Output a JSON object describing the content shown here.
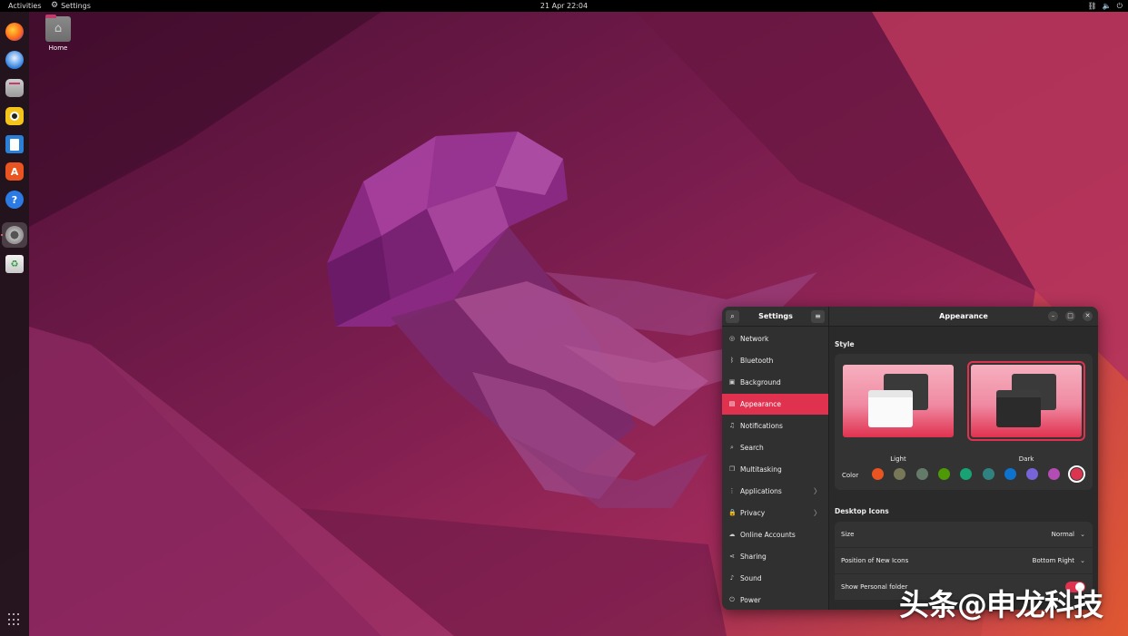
{
  "topbar": {
    "activities": "Activities",
    "app_name": "Settings",
    "clock": "21 Apr  22:04",
    "tray_icons": [
      "network-icon",
      "volume-icon",
      "power-icon"
    ]
  },
  "dock": {
    "apps": [
      {
        "name": "Firefox",
        "icon": "firefox-icon"
      },
      {
        "name": "Thunderbird",
        "icon": "thunderbird-icon"
      },
      {
        "name": "Files",
        "icon": "files-icon"
      },
      {
        "name": "Rhythmbox",
        "icon": "rhythmbox-icon"
      },
      {
        "name": "LibreOffice Writer",
        "icon": "writer-icon"
      },
      {
        "name": "Ubuntu Software",
        "icon": "software-icon"
      },
      {
        "name": "Help",
        "icon": "help-icon"
      },
      {
        "name": "Settings",
        "icon": "settings-icon"
      },
      {
        "name": "Trash",
        "icon": "trash-icon"
      }
    ],
    "show_apps_icon": "grid-icon"
  },
  "desktop": {
    "home_label": "Home"
  },
  "settings": {
    "sidebar_title": "Settings",
    "sidebar_items": [
      {
        "label": "Network",
        "icon": "network-icon"
      },
      {
        "label": "Bluetooth",
        "icon": "bluetooth-icon"
      },
      {
        "label": "Background",
        "icon": "background-icon"
      },
      {
        "label": "Appearance",
        "icon": "appearance-icon",
        "active": true
      },
      {
        "label": "Notifications",
        "icon": "bell-icon"
      },
      {
        "label": "Search",
        "icon": "search-icon"
      },
      {
        "label": "Multitasking",
        "icon": "multitasking-icon"
      },
      {
        "label": "Applications",
        "icon": "apps-icon",
        "chevron": true
      },
      {
        "label": "Privacy",
        "icon": "lock-icon",
        "chevron": true
      },
      {
        "label": "Online Accounts",
        "icon": "cloud-icon"
      },
      {
        "label": "Sharing",
        "icon": "share-icon"
      },
      {
        "label": "Sound",
        "icon": "music-icon"
      },
      {
        "label": "Power",
        "icon": "power-icon"
      }
    ],
    "page_title": "Appearance",
    "style_section": "Style",
    "style_options": {
      "light": "Light",
      "dark": "Dark",
      "selected": "Dark"
    },
    "color_label": "Color",
    "accent_colors": [
      "#e95420",
      "#787859",
      "#657b69",
      "#4e9a06",
      "#18a374",
      "#308280",
      "#0e73cc",
      "#7764d8",
      "#b34cb3",
      "#da3450"
    ],
    "selected_accent": "#da3450",
    "desktop_icons_section": "Desktop Icons",
    "rows": {
      "size_label": "Size",
      "size_value": "Normal",
      "position_label": "Position of New Icons",
      "position_value": "Bottom Right",
      "personal_folder_label": "Show Personal folder",
      "personal_folder_on": true
    }
  },
  "watermark": "头条@申龙科技"
}
